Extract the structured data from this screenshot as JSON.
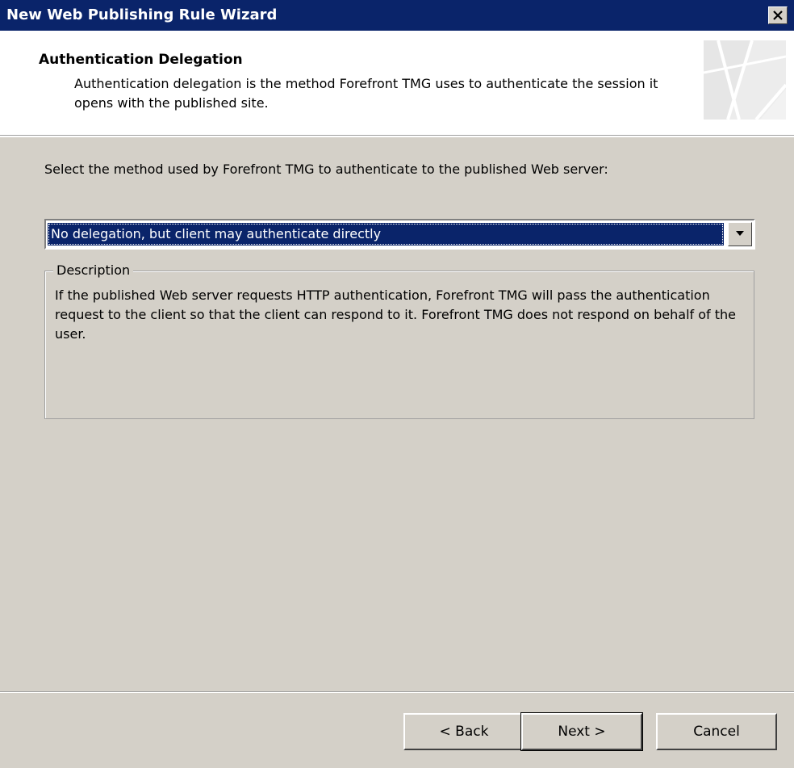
{
  "window": {
    "title": "New Web Publishing Rule Wizard",
    "close_label": "×"
  },
  "header": {
    "title": "Authentication Delegation",
    "description": "Authentication delegation is the method Forefront TMG uses to authenticate the session it opens with the published site."
  },
  "body": {
    "prompt": "Select the method used by Forefront TMG to authenticate to the published Web server:",
    "method_select": {
      "selected": "No delegation, but client may authenticate directly"
    },
    "description_group": {
      "legend": "Description",
      "text": "If the published Web server requests HTTP authentication, Forefront TMG will pass the authentication request to the client so that the client can respond to it. Forefront TMG does not respond on behalf of the user."
    }
  },
  "footer": {
    "back_label": "< Back",
    "next_label": "Next >",
    "cancel_label": "Cancel"
  },
  "icons": {
    "close": "close-icon",
    "dropdown": "chevron-down-icon",
    "header_graphic": "wizard-banner-graphic"
  },
  "colors": {
    "titlebar": "#0a246a",
    "dialog_face": "#d4d0c8",
    "selection": "#0a246a"
  }
}
